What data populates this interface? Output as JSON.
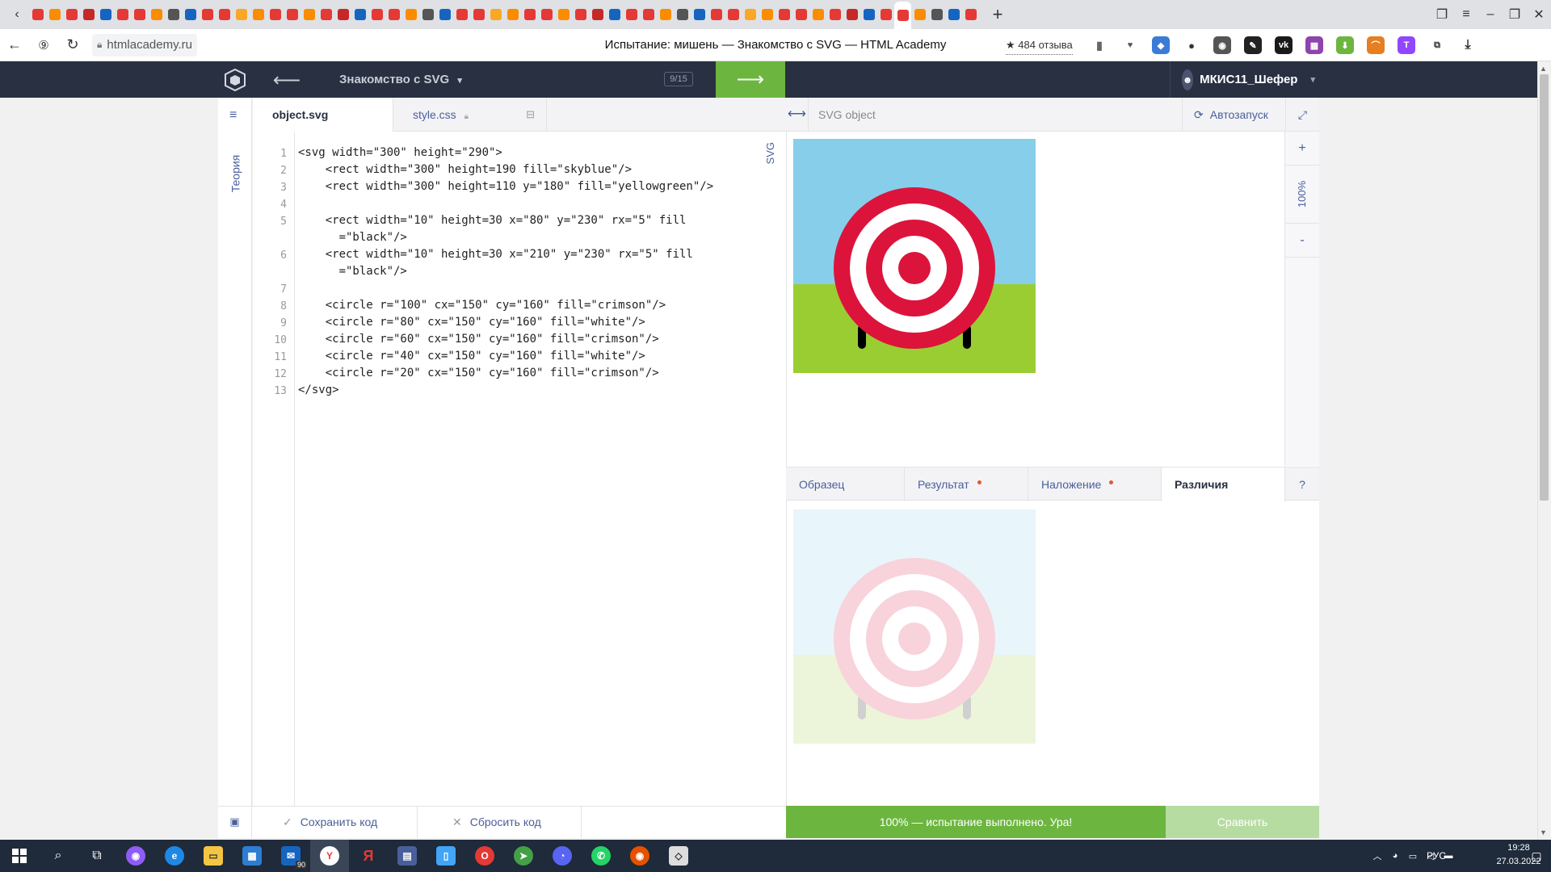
{
  "browser": {
    "url": "htmlacademy.ru",
    "page_title": "Испытание: мишень — Знакомство с SVG — HTML Academy",
    "reviews_label": "★ 484 отзыва"
  },
  "header": {
    "course_title": "Знакомство с SVG",
    "progress": "9/15",
    "user_name": "МКИС11_Шефер"
  },
  "sidebar": {
    "theory_label": "Теория"
  },
  "editor": {
    "tabs": [
      {
        "label": "object.svg"
      },
      {
        "label": "style.css"
      }
    ],
    "side_label": "SVG",
    "line_numbers": [
      "1",
      "2",
      "3",
      "4",
      "5",
      "",
      "6",
      "",
      "7",
      "8",
      "9",
      "10",
      "11",
      "12",
      "13"
    ],
    "code_lines": [
      "<svg width=\"300\" height=\"290\">",
      "    <rect width=\"300\" height=190 fill=\"skyblue\"/>",
      "    <rect width=\"300\" height=110 y=\"180\" fill=\"yellowgreen\"/>",
      "",
      "    <rect width=\"10\" height=30 x=\"80\" y=\"230\" rx=\"5\" fill",
      "      =\"black\"/>",
      "    <rect width=\"10\" height=30 x=\"210\" y=\"230\" rx=\"5\" fill",
      "      =\"black\"/>",
      "",
      "    <circle r=\"100\" cx=\"150\" cy=\"160\" fill=\"crimson\"/>",
      "    <circle r=\"80\" cx=\"150\" cy=\"160\" fill=\"white\"/>",
      "    <circle r=\"60\" cx=\"150\" cy=\"160\" fill=\"crimson\"/>",
      "    <circle r=\"40\" cx=\"150\" cy=\"160\" fill=\"white\"/>",
      "    <circle r=\"20\" cx=\"150\" cy=\"160\" fill=\"crimson\"/>",
      "</svg>"
    ]
  },
  "preview": {
    "title": "SVG object",
    "autorun_label": "Автозапуск",
    "zoom_plus": "+",
    "zoom_level": "100%",
    "zoom_minus": "-"
  },
  "compare_tabs": {
    "tabs": [
      {
        "label": "Образец"
      },
      {
        "label": "Результат"
      },
      {
        "label": "Наложение"
      },
      {
        "label": "Различия"
      }
    ],
    "help": "?"
  },
  "footer": {
    "save_label": "Сохранить код",
    "reset_label": "Сбросить код",
    "success_text": "100% — испытание выполнено. Ура!",
    "compare_label": "Сравнить"
  },
  "taskbar": {
    "lang": "РУС",
    "time": "19:28",
    "date": "27.03.2022",
    "mail_badge": "90"
  },
  "colors": {
    "header_bg": "#283042",
    "accent_green": "#6cb63f",
    "link_blue": "#4a5f9a",
    "sky": "#87ceeb",
    "grass": "#9acd32",
    "crimson": "#dc143c"
  }
}
